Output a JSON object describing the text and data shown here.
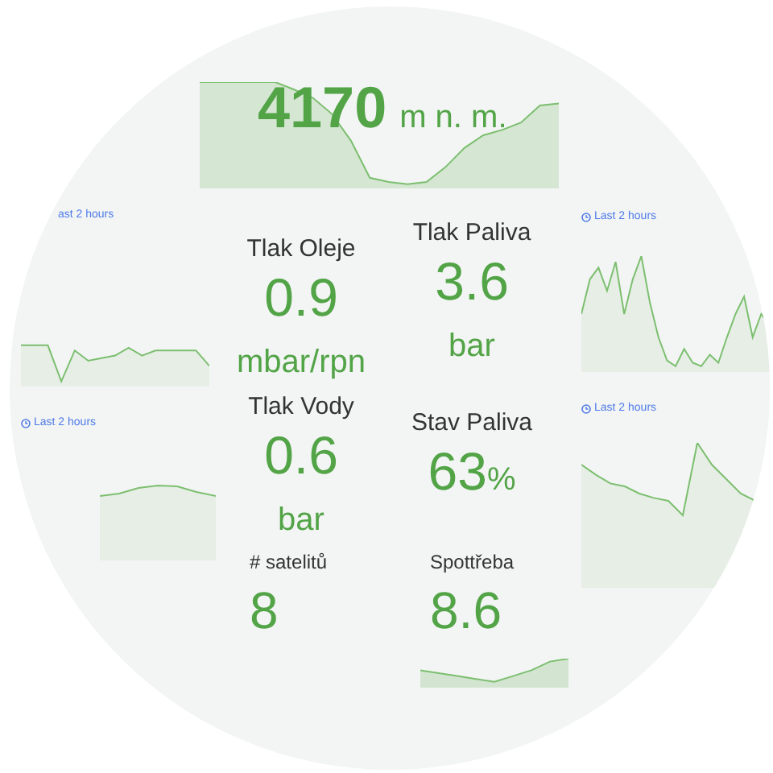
{
  "altitude": {
    "value": "4170",
    "unit": "m n. m."
  },
  "left_panels": [
    {
      "time_range": "ast 2 hours",
      "clock": false
    },
    {
      "time_range": "Last 2 hours",
      "clock": true
    }
  ],
  "stats": [
    {
      "kind": "stacked",
      "title": "Tlak Oleje",
      "value": "0.9",
      "unit": "mbar/rpn"
    },
    {
      "kind": "stacked",
      "title": "Tlak Paliva",
      "value": "3.6",
      "unit": "bar"
    },
    {
      "kind": "stacked",
      "title": "Tlak Vody",
      "value": "0.6",
      "unit": "bar"
    },
    {
      "kind": "inline",
      "title": "Stav Paliva",
      "value": "63",
      "unit": "%"
    },
    {
      "kind": "compact",
      "title": "# satelitů",
      "value": "8"
    },
    {
      "kind": "compact",
      "title": "Spottřeba",
      "value": "8.6"
    }
  ],
  "right_panels": [
    {
      "time_range": "Last 2 hours",
      "clock": true
    },
    {
      "time_range": "Last 2 hours",
      "clock": true
    }
  ]
}
